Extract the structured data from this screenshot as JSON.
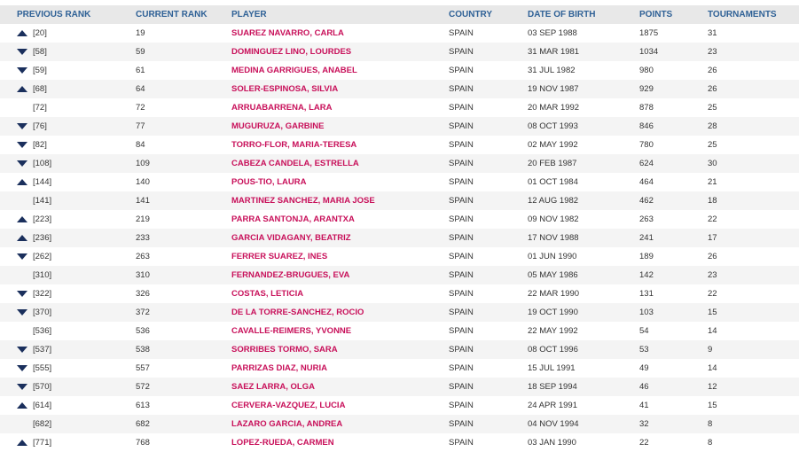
{
  "headers": {
    "previous_rank": "PREVIOUS RANK",
    "current_rank": "CURRENT RANK",
    "player": "PLAYER",
    "country": "COUNTRY",
    "dob": "DATE OF BIRTH",
    "points": "POINTS",
    "tournaments": "TOURNAMENTS"
  },
  "colors": {
    "header_text": "#2f6196",
    "player_link": "#c8105a",
    "header_bg": "#e8e8e8"
  },
  "rows": [
    {
      "trend": "up",
      "previous": "[20]",
      "current": "19",
      "player": "SUAREZ NAVARRO, CARLA",
      "country": "SPAIN",
      "dob": "03 SEP 1988",
      "points": "1875",
      "tournaments": "31"
    },
    {
      "trend": "down",
      "previous": "[58]",
      "current": "59",
      "player": "DOMINGUEZ LINO, LOURDES",
      "country": "SPAIN",
      "dob": "31 MAR 1981",
      "points": "1034",
      "tournaments": "23"
    },
    {
      "trend": "down",
      "previous": "[59]",
      "current": "61",
      "player": "MEDINA GARRIGUES, ANABEL",
      "country": "SPAIN",
      "dob": "31 JUL 1982",
      "points": "980",
      "tournaments": "26"
    },
    {
      "trend": "up",
      "previous": "[68]",
      "current": "64",
      "player": "SOLER-ESPINOSA, SILVIA",
      "country": "SPAIN",
      "dob": "19 NOV 1987",
      "points": "929",
      "tournaments": "26"
    },
    {
      "trend": "none",
      "previous": "[72]",
      "current": "72",
      "player": "ARRUABARRENA, LARA",
      "country": "SPAIN",
      "dob": "20 MAR 1992",
      "points": "878",
      "tournaments": "25"
    },
    {
      "trend": "down",
      "previous": "[76]",
      "current": "77",
      "player": "MUGURUZA, GARBINE",
      "country": "SPAIN",
      "dob": "08 OCT 1993",
      "points": "846",
      "tournaments": "28"
    },
    {
      "trend": "down",
      "previous": "[82]",
      "current": "84",
      "player": "TORRO-FLOR, MARIA-TERESA",
      "country": "SPAIN",
      "dob": "02 MAY 1992",
      "points": "780",
      "tournaments": "25"
    },
    {
      "trend": "down",
      "previous": "[108]",
      "current": "109",
      "player": "CABEZA CANDELA, ESTRELLA",
      "country": "SPAIN",
      "dob": "20 FEB 1987",
      "points": "624",
      "tournaments": "30"
    },
    {
      "trend": "up",
      "previous": "[144]",
      "current": "140",
      "player": "POUS-TIO, LAURA",
      "country": "SPAIN",
      "dob": "01 OCT 1984",
      "points": "464",
      "tournaments": "21"
    },
    {
      "trend": "none",
      "previous": "[141]",
      "current": "141",
      "player": "MARTINEZ SANCHEZ, MARIA JOSE",
      "country": "SPAIN",
      "dob": "12 AUG 1982",
      "points": "462",
      "tournaments": "18"
    },
    {
      "trend": "up",
      "previous": "[223]",
      "current": "219",
      "player": "PARRA SANTONJA, ARANTXA",
      "country": "SPAIN",
      "dob": "09 NOV 1982",
      "points": "263",
      "tournaments": "22"
    },
    {
      "trend": "up",
      "previous": "[236]",
      "current": "233",
      "player": "GARCIA VIDAGANY, BEATRIZ",
      "country": "SPAIN",
      "dob": "17 NOV 1988",
      "points": "241",
      "tournaments": "17"
    },
    {
      "trend": "down",
      "previous": "[262]",
      "current": "263",
      "player": "FERRER SUAREZ, INES",
      "country": "SPAIN",
      "dob": "01 JUN 1990",
      "points": "189",
      "tournaments": "26"
    },
    {
      "trend": "none",
      "previous": "[310]",
      "current": "310",
      "player": "FERNANDEZ-BRUGUES, EVA",
      "country": "SPAIN",
      "dob": "05 MAY 1986",
      "points": "142",
      "tournaments": "23"
    },
    {
      "trend": "down",
      "previous": "[322]",
      "current": "326",
      "player": "COSTAS, LETICIA",
      "country": "SPAIN",
      "dob": "22 MAR 1990",
      "points": "131",
      "tournaments": "22"
    },
    {
      "trend": "down",
      "previous": "[370]",
      "current": "372",
      "player": "DE LA TORRE-SANCHEZ, ROCIO",
      "country": "SPAIN",
      "dob": "19 OCT 1990",
      "points": "103",
      "tournaments": "15"
    },
    {
      "trend": "none",
      "previous": "[536]",
      "current": "536",
      "player": "CAVALLE-REIMERS, YVONNE",
      "country": "SPAIN",
      "dob": "22 MAY 1992",
      "points": "54",
      "tournaments": "14"
    },
    {
      "trend": "down",
      "previous": "[537]",
      "current": "538",
      "player": "SORRIBES TORMO, SARA",
      "country": "SPAIN",
      "dob": "08 OCT 1996",
      "points": "53",
      "tournaments": "9"
    },
    {
      "trend": "down",
      "previous": "[555]",
      "current": "557",
      "player": "PARRIZAS DIAZ, NURIA",
      "country": "SPAIN",
      "dob": "15 JUL 1991",
      "points": "49",
      "tournaments": "14"
    },
    {
      "trend": "down",
      "previous": "[570]",
      "current": "572",
      "player": "SAEZ LARRA, OLGA",
      "country": "SPAIN",
      "dob": "18 SEP 1994",
      "points": "46",
      "tournaments": "12"
    },
    {
      "trend": "up",
      "previous": "[614]",
      "current": "613",
      "player": "CERVERA-VAZQUEZ, LUCIA",
      "country": "SPAIN",
      "dob": "24 APR 1991",
      "points": "41",
      "tournaments": "15"
    },
    {
      "trend": "none",
      "previous": "[682]",
      "current": "682",
      "player": "LAZARO GARCIA, ANDREA",
      "country": "SPAIN",
      "dob": "04 NOV 1994",
      "points": "32",
      "tournaments": "8"
    },
    {
      "trend": "up",
      "previous": "[771]",
      "current": "768",
      "player": "LOPEZ-RUEDA, CARMEN",
      "country": "SPAIN",
      "dob": "03 JAN 1990",
      "points": "22",
      "tournaments": "8"
    }
  ]
}
